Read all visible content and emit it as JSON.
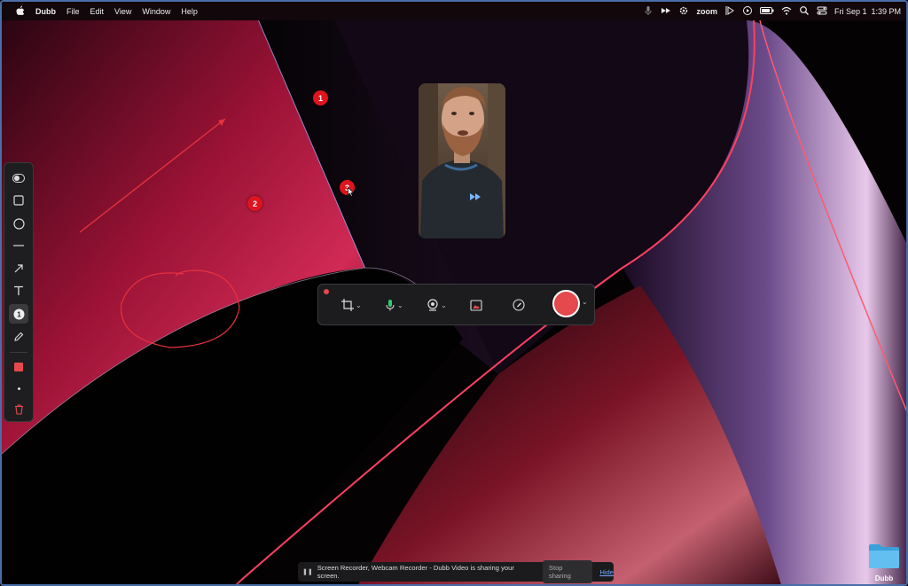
{
  "menubar": {
    "apple_icon": "apple-icon",
    "app_name": "Dubb",
    "menus": [
      "File",
      "Edit",
      "View",
      "Window",
      "Help"
    ],
    "status_icons": [
      "mic-icon",
      "dubb-icon",
      "gear-icon",
      "zoom-text",
      "play-icon",
      "record-icon",
      "battery-icon",
      "wifi-icon",
      "search-icon",
      "control-center-icon"
    ],
    "zoom_label": "zoom",
    "datetime": "Fri Sep 1  1:39 PM"
  },
  "annotation_toolbar": {
    "tools": [
      "toggle-icon",
      "rectangle-icon",
      "circle-icon",
      "line-icon",
      "arrow-icon",
      "text-icon",
      "number-marker-icon",
      "pencil-icon"
    ],
    "active_tool": "number-marker-icon",
    "color": "#e5484d",
    "size_icon": "brush-size-icon",
    "delete_icon": "trash-icon"
  },
  "markers": [
    "1",
    "2",
    "3"
  ],
  "recorder": {
    "buttons": [
      "crop-icon",
      "microphone-icon",
      "webcam-icon",
      "screen-icon",
      "annotate-icon"
    ],
    "record_color": "#e5484d"
  },
  "sharebar": {
    "message": "Screen Recorder, Webcam Recorder - Dubb Video is sharing your screen.",
    "stop_label": "Stop sharing",
    "hide_label": "Hide"
  },
  "desktop": {
    "folder_label": "Dubb"
  },
  "colors": {
    "accent_red": "#e5484d",
    "wallpaper_red": "#8a0f2e",
    "link_blue": "#6fa3ff"
  }
}
